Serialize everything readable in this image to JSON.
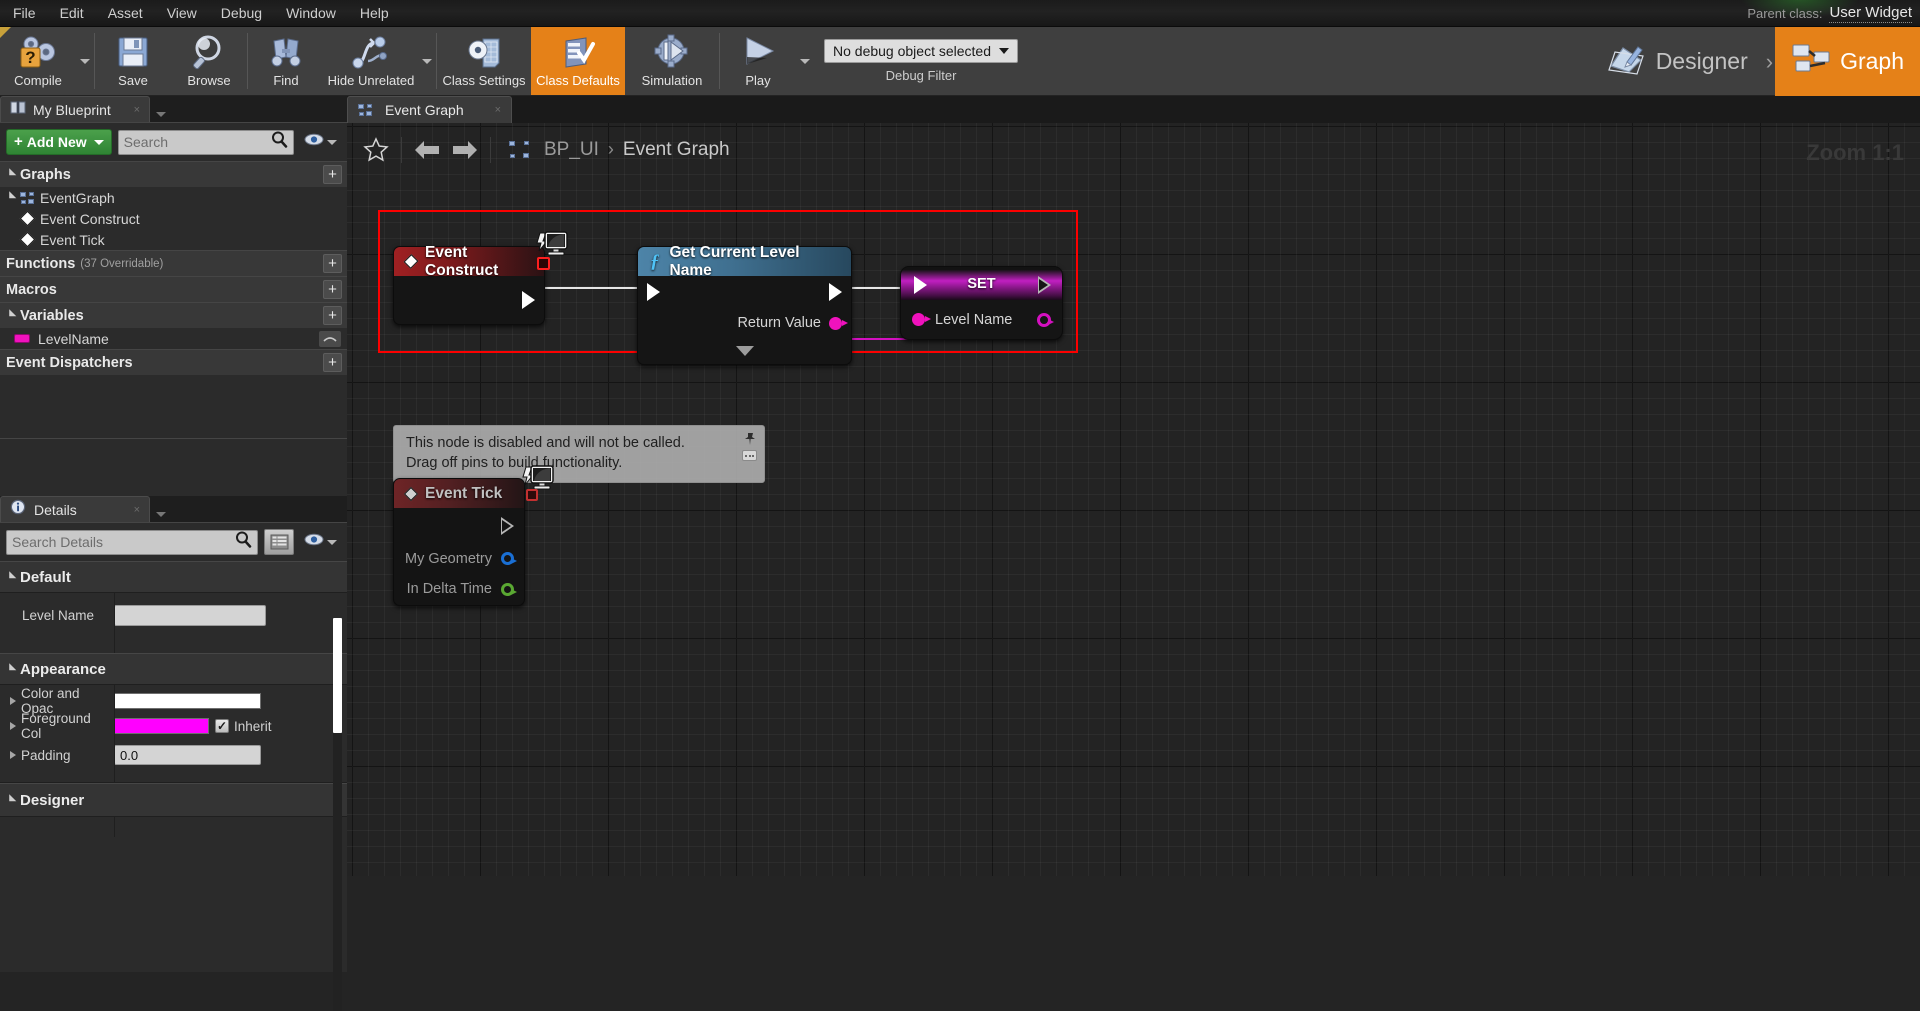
{
  "menubar": {
    "items": [
      "File",
      "Edit",
      "Asset",
      "View",
      "Debug",
      "Window",
      "Help"
    ],
    "parent_class_label": "Parent class:",
    "parent_class_value": "User Widget"
  },
  "toolbar": {
    "compile": "Compile",
    "save": "Save",
    "browse": "Browse",
    "find": "Find",
    "hide_unrelated": "Hide Unrelated",
    "class_settings": "Class Settings",
    "class_defaults": "Class Defaults",
    "simulation": "Simulation",
    "play": "Play",
    "debug_object": "No debug object selected",
    "debug_filter_label": "Debug Filter",
    "accent_color": "#e58118"
  },
  "modeswitch": {
    "designer": "Designer",
    "graph": "Graph",
    "separator": "›",
    "active": "Graph"
  },
  "my_blueprint": {
    "tab_label": "My Blueprint",
    "tab_close": "×",
    "add_new": "Add New",
    "search_placeholder": "Search",
    "sections": [
      {
        "label": "Graphs",
        "sub": "",
        "plus": "+"
      },
      {
        "label": "Functions",
        "sub": "(37 Overridable)",
        "plus": "+"
      },
      {
        "label": "Macros",
        "sub": "",
        "plus": "+"
      },
      {
        "label": "Variables",
        "sub": "",
        "plus": "+"
      },
      {
        "label": "Event Dispatchers",
        "sub": "",
        "plus": "+"
      }
    ],
    "graph_name": "EventGraph",
    "graph_items": [
      "Event Construct",
      "Event Tick"
    ],
    "variables": [
      {
        "name": "LevelName",
        "color": "#f012bd"
      }
    ]
  },
  "details": {
    "tab_label": "Details",
    "tab_close": "×",
    "search_placeholder": "Search Details",
    "categories": {
      "default": "Default",
      "appearance": "Appearance",
      "designer": "Designer"
    },
    "properties": [
      {
        "name": "Level Name",
        "type": "text",
        "value": ""
      },
      {
        "name": "Color and Opac",
        "type": "color",
        "value": "#ffffff"
      },
      {
        "name": "Foreground Col",
        "type": "color",
        "value": "#ff00ff",
        "checkbox_label": "Inherit",
        "checked": true
      },
      {
        "name": "Padding",
        "type": "text",
        "value": "0.0"
      }
    ]
  },
  "graph": {
    "tab_label": "Event Graph",
    "tab_close": "×",
    "breadcrumb_root": "BP_UI",
    "breadcrumb_current": "Event Graph",
    "breadcrumb_sep": "›",
    "zoom_label": "Zoom 1:1",
    "selection_color": "#fc0000"
  },
  "nodes": {
    "event_construct": {
      "title": "Event Construct",
      "disabled": false
    },
    "get_level_name": {
      "title": "Get Current Level Name",
      "fn_glyph": "ƒ",
      "output_pin": "Return Value",
      "output_pin_color": "#f012bd"
    },
    "set_node": {
      "title": "SET",
      "pin_label": "Level Name",
      "pin_color": "#f012bd"
    },
    "event_tick": {
      "title": "Event Tick",
      "disabled": true,
      "pins": [
        {
          "label": "My Geometry",
          "color": "#1a6fd4"
        },
        {
          "label": "In Delta Time",
          "color": "#5aa832"
        }
      ],
      "tooltip_line1": "This node is disabled and will not be called.",
      "tooltip_line2": "Drag off pins to build functionality."
    }
  }
}
